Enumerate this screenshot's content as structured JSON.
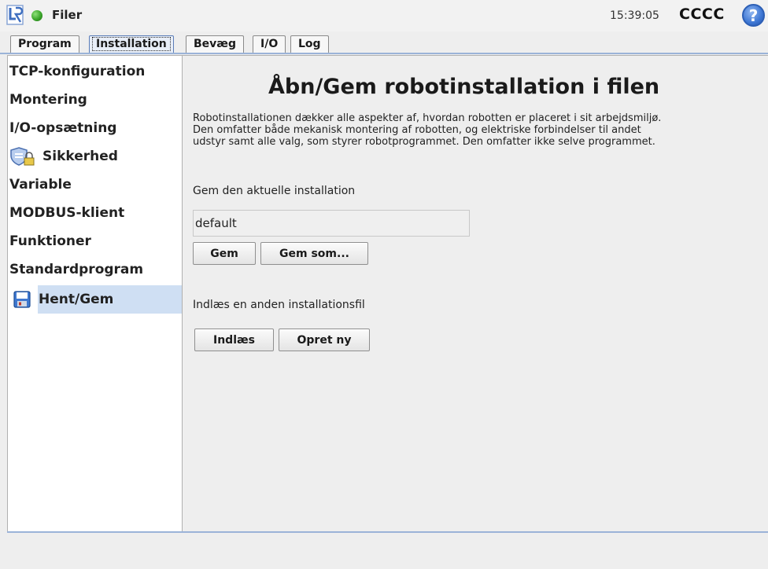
{
  "titlebar": {
    "app_title": "Filer",
    "clock": "15:39:05",
    "robot_name": "CCCC",
    "help_label": "?"
  },
  "tabs": [
    {
      "label": "Program",
      "active": false
    },
    {
      "label": "Installation",
      "active": true
    },
    {
      "label": "Bevæg",
      "active": false
    },
    {
      "label": "I/O",
      "active": false
    },
    {
      "label": "Log",
      "active": false
    }
  ],
  "sidebar": {
    "items": [
      {
        "label": "TCP-konfiguration"
      },
      {
        "label": "Montering"
      },
      {
        "label": "I/O-opsætning"
      },
      {
        "label": "Sikkerhed",
        "icon": "shield-lock-icon"
      },
      {
        "label": "Variable"
      },
      {
        "label": "MODBUS-klient"
      },
      {
        "label": "Funktioner"
      },
      {
        "label": "Standardprogram"
      },
      {
        "label": "Hent/Gem",
        "icon": "floppy-disk-icon",
        "selected": true
      }
    ]
  },
  "main": {
    "heading": "Åbn/Gem robotinstallation i filen",
    "description": [
      "Robotinstallationen dækker alle aspekter af, hvordan robotten er placeret i sit arbejdsmiljø.",
      "Den omfatter både mekanisk montering af robotten, og elektriske forbindelser til andet",
      "udstyr samt alle valg, som styrer robotprogrammet. Den omfatter ikke selve programmet."
    ],
    "save_section_label": "Gem den aktuelle installation",
    "installation_name": "default",
    "save_button": "Gem",
    "save_as_button": "Gem som...",
    "load_section_label": "Indlæs en anden installationsfil",
    "load_button": "Indlæs",
    "new_button": "Opret ny"
  },
  "colors": {
    "accent": "#9bb3d8",
    "selected_bg": "#cfdff3",
    "status_ok": "#3aa52a"
  }
}
